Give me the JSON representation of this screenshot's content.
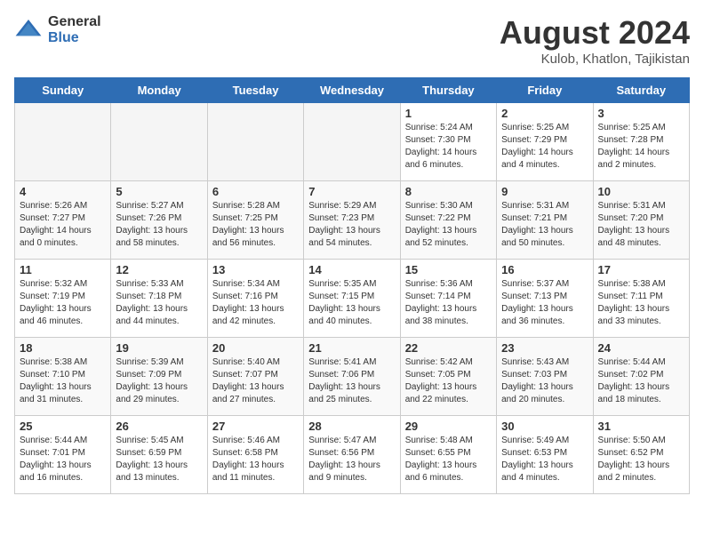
{
  "header": {
    "logo_general": "General",
    "logo_blue": "Blue",
    "month_year": "August 2024",
    "location": "Kulob, Khatlon, Tajikistan"
  },
  "days_of_week": [
    "Sunday",
    "Monday",
    "Tuesday",
    "Wednesday",
    "Thursday",
    "Friday",
    "Saturday"
  ],
  "weeks": [
    [
      {
        "day": "",
        "empty": true
      },
      {
        "day": "",
        "empty": true
      },
      {
        "day": "",
        "empty": true
      },
      {
        "day": "",
        "empty": true
      },
      {
        "day": "1",
        "sunrise": "5:24 AM",
        "sunset": "7:30 PM",
        "daylight": "14 hours and 6 minutes."
      },
      {
        "day": "2",
        "sunrise": "5:25 AM",
        "sunset": "7:29 PM",
        "daylight": "14 hours and 4 minutes."
      },
      {
        "day": "3",
        "sunrise": "5:25 AM",
        "sunset": "7:28 PM",
        "daylight": "14 hours and 2 minutes."
      }
    ],
    [
      {
        "day": "4",
        "sunrise": "5:26 AM",
        "sunset": "7:27 PM",
        "daylight": "14 hours and 0 minutes."
      },
      {
        "day": "5",
        "sunrise": "5:27 AM",
        "sunset": "7:26 PM",
        "daylight": "13 hours and 58 minutes."
      },
      {
        "day": "6",
        "sunrise": "5:28 AM",
        "sunset": "7:25 PM",
        "daylight": "13 hours and 56 minutes."
      },
      {
        "day": "7",
        "sunrise": "5:29 AM",
        "sunset": "7:23 PM",
        "daylight": "13 hours and 54 minutes."
      },
      {
        "day": "8",
        "sunrise": "5:30 AM",
        "sunset": "7:22 PM",
        "daylight": "13 hours and 52 minutes."
      },
      {
        "day": "9",
        "sunrise": "5:31 AM",
        "sunset": "7:21 PM",
        "daylight": "13 hours and 50 minutes."
      },
      {
        "day": "10",
        "sunrise": "5:31 AM",
        "sunset": "7:20 PM",
        "daylight": "13 hours and 48 minutes."
      }
    ],
    [
      {
        "day": "11",
        "sunrise": "5:32 AM",
        "sunset": "7:19 PM",
        "daylight": "13 hours and 46 minutes."
      },
      {
        "day": "12",
        "sunrise": "5:33 AM",
        "sunset": "7:18 PM",
        "daylight": "13 hours and 44 minutes."
      },
      {
        "day": "13",
        "sunrise": "5:34 AM",
        "sunset": "7:16 PM",
        "daylight": "13 hours and 42 minutes."
      },
      {
        "day": "14",
        "sunrise": "5:35 AM",
        "sunset": "7:15 PM",
        "daylight": "13 hours and 40 minutes."
      },
      {
        "day": "15",
        "sunrise": "5:36 AM",
        "sunset": "7:14 PM",
        "daylight": "13 hours and 38 minutes."
      },
      {
        "day": "16",
        "sunrise": "5:37 AM",
        "sunset": "7:13 PM",
        "daylight": "13 hours and 36 minutes."
      },
      {
        "day": "17",
        "sunrise": "5:38 AM",
        "sunset": "7:11 PM",
        "daylight": "13 hours and 33 minutes."
      }
    ],
    [
      {
        "day": "18",
        "sunrise": "5:38 AM",
        "sunset": "7:10 PM",
        "daylight": "13 hours and 31 minutes."
      },
      {
        "day": "19",
        "sunrise": "5:39 AM",
        "sunset": "7:09 PM",
        "daylight": "13 hours and 29 minutes."
      },
      {
        "day": "20",
        "sunrise": "5:40 AM",
        "sunset": "7:07 PM",
        "daylight": "13 hours and 27 minutes."
      },
      {
        "day": "21",
        "sunrise": "5:41 AM",
        "sunset": "7:06 PM",
        "daylight": "13 hours and 25 minutes."
      },
      {
        "day": "22",
        "sunrise": "5:42 AM",
        "sunset": "7:05 PM",
        "daylight": "13 hours and 22 minutes."
      },
      {
        "day": "23",
        "sunrise": "5:43 AM",
        "sunset": "7:03 PM",
        "daylight": "13 hours and 20 minutes."
      },
      {
        "day": "24",
        "sunrise": "5:44 AM",
        "sunset": "7:02 PM",
        "daylight": "13 hours and 18 minutes."
      }
    ],
    [
      {
        "day": "25",
        "sunrise": "5:44 AM",
        "sunset": "7:01 PM",
        "daylight": "13 hours and 16 minutes."
      },
      {
        "day": "26",
        "sunrise": "5:45 AM",
        "sunset": "6:59 PM",
        "daylight": "13 hours and 13 minutes."
      },
      {
        "day": "27",
        "sunrise": "5:46 AM",
        "sunset": "6:58 PM",
        "daylight": "13 hours and 11 minutes."
      },
      {
        "day": "28",
        "sunrise": "5:47 AM",
        "sunset": "6:56 PM",
        "daylight": "13 hours and 9 minutes."
      },
      {
        "day": "29",
        "sunrise": "5:48 AM",
        "sunset": "6:55 PM",
        "daylight": "13 hours and 6 minutes."
      },
      {
        "day": "30",
        "sunrise": "5:49 AM",
        "sunset": "6:53 PM",
        "daylight": "13 hours and 4 minutes."
      },
      {
        "day": "31",
        "sunrise": "5:50 AM",
        "sunset": "6:52 PM",
        "daylight": "13 hours and 2 minutes."
      }
    ]
  ],
  "labels": {
    "sunrise": "Sunrise:",
    "sunset": "Sunset:",
    "daylight": "Daylight hours"
  }
}
